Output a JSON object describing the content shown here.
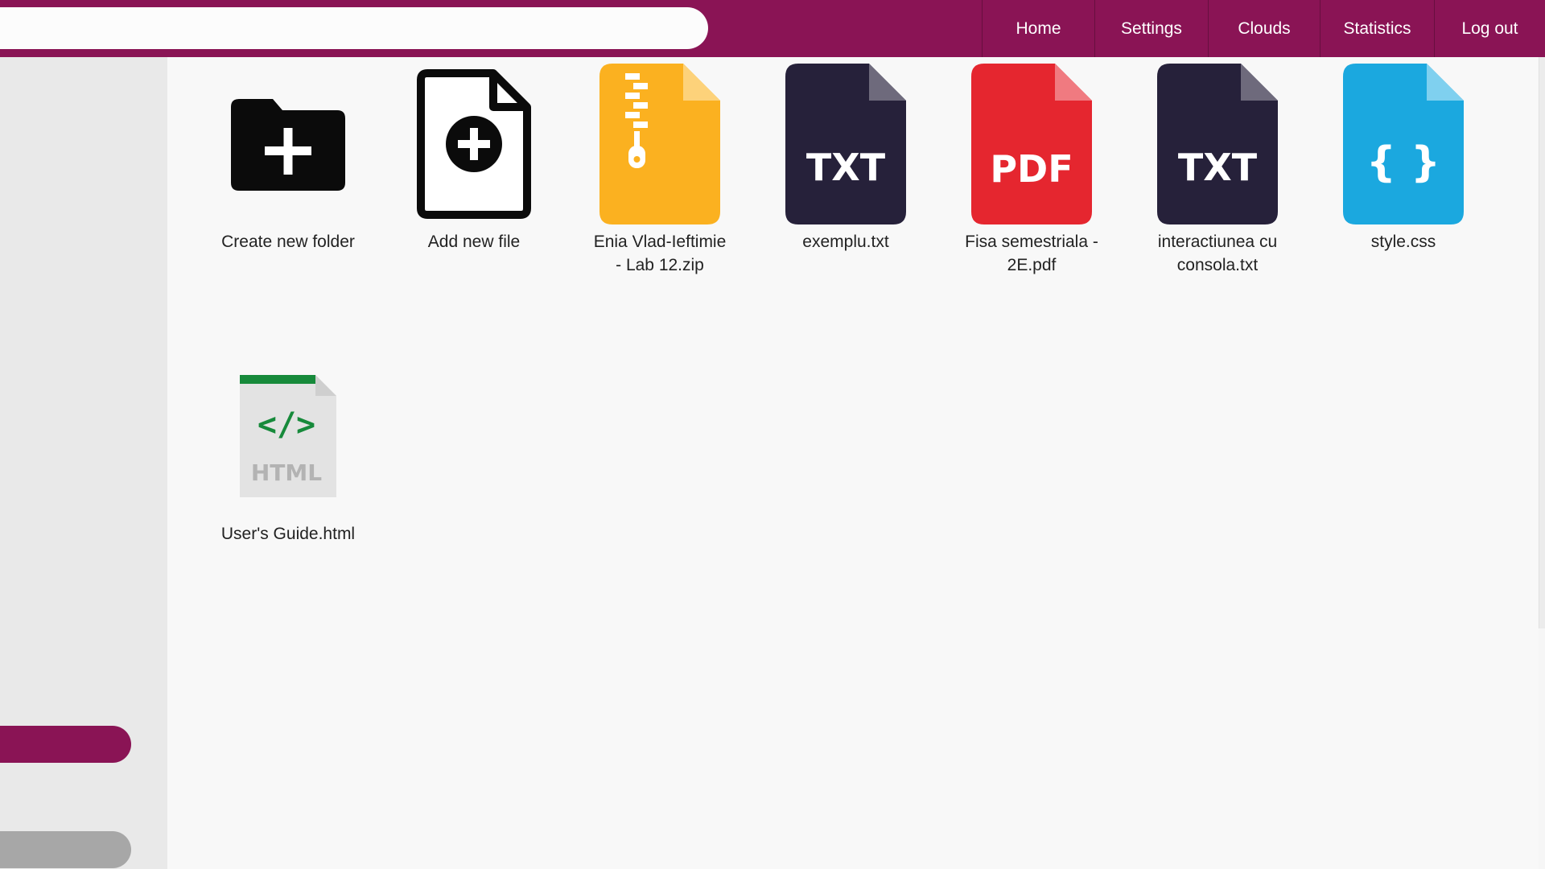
{
  "search": {
    "value": "",
    "placeholder": ""
  },
  "nav": {
    "home": "Home",
    "settings": "Settings",
    "clouds": "Clouds",
    "statistics": "Statistics",
    "logout": "Log out"
  },
  "colors": {
    "brand": "#8a1455",
    "zip": "#fbb120",
    "txt": "#26213a",
    "pdf": "#e5262f",
    "css": "#1ba8df",
    "html_green": "#178a3b"
  },
  "tiles": [
    {
      "label": "Create new folder",
      "icon": "folder-plus-icon"
    },
    {
      "label": "Add new file",
      "icon": "file-plus-icon"
    },
    {
      "label": "Enia Vlad-Ieftimie - Lab 12.zip",
      "icon": "zip-file-icon"
    },
    {
      "label": "exemplu.txt",
      "icon": "txt-file-icon",
      "badge": "TXT"
    },
    {
      "label": "Fisa semestriala - 2E.pdf",
      "icon": "pdf-file-icon",
      "badge": "PDF"
    },
    {
      "label": "interactiunea cu consola.txt",
      "icon": "txt-file-icon",
      "badge": "TXT"
    },
    {
      "label": "style.css",
      "icon": "css-file-icon",
      "badge": "{ }"
    },
    {
      "label": "User's Guide.html",
      "icon": "html-file-icon",
      "badge": "HTML",
      "code": "</>"
    }
  ]
}
